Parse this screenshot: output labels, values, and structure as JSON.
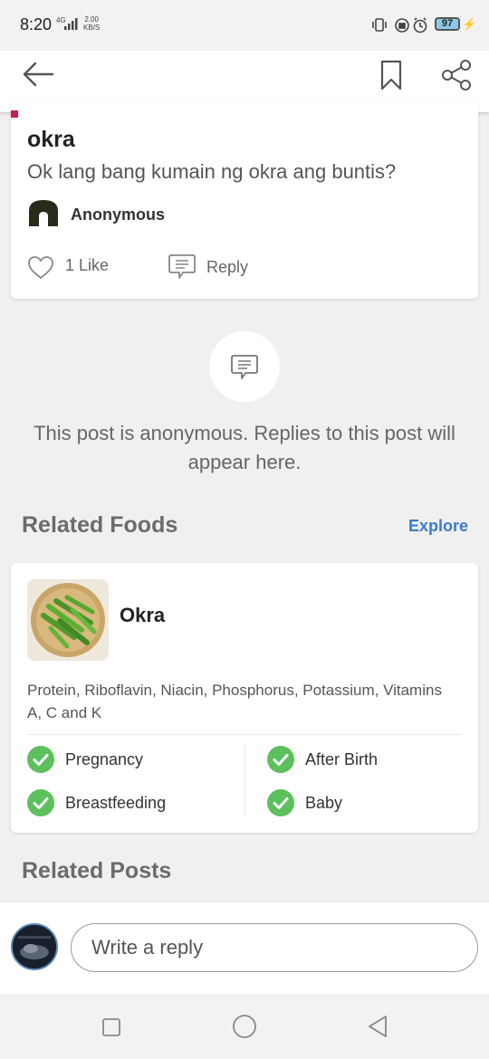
{
  "status": {
    "time": "8:20",
    "network": "4G",
    "speed_value": "2.00",
    "speed_unit": "KB/S",
    "battery": "97"
  },
  "post": {
    "title": "okra",
    "body": "Ok lang bang kumain ng okra ang buntis?",
    "author": "Anonymous",
    "likes_label": "1 Like",
    "reply_label": "Reply"
  },
  "anonymous_notice": "This post is anonymous. Replies to this post will appear here.",
  "related_foods": {
    "title": "Related Foods",
    "explore_label": "Explore",
    "food": {
      "name": "Okra",
      "nutrients": "Protein, Riboflavin, Niacin, Phosphorus, Potassium, Vitamins A, C and K",
      "safety": [
        {
          "label": "Pregnancy"
        },
        {
          "label": "After Birth"
        },
        {
          "label": "Breastfeeding"
        },
        {
          "label": "Baby"
        }
      ]
    }
  },
  "related_posts": {
    "title": "Related Posts"
  },
  "reply_bar": {
    "placeholder": "Write a reply"
  },
  "colors": {
    "accent_blue": "#3b7dc8",
    "check_green": "#5cc05c",
    "pink_marker": "#d0195e"
  }
}
